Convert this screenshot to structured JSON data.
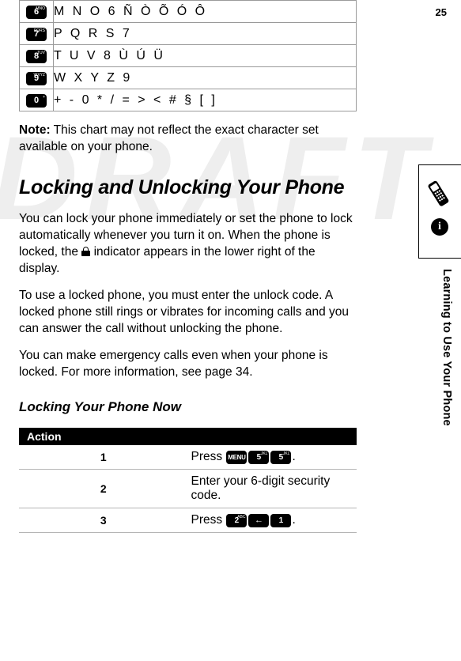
{
  "page": {
    "number": "25",
    "watermark": "DRAFT",
    "rail_title": "Learning to Use Your Phone",
    "rail_info_glyph": "i"
  },
  "chart": {
    "rows": [
      {
        "key": "6",
        "key_sub": "MNO",
        "chars": "M  N  O  6  Ñ  Ò  Õ  Ó  Ô"
      },
      {
        "key": "7",
        "key_sub": "PQRS",
        "chars": "P  Q  R  S  7"
      },
      {
        "key": "8",
        "key_sub": "TUV",
        "chars": "T  U  V  8  Ù  Ú  Ü"
      },
      {
        "key": "9",
        "key_sub": "WXYZ",
        "chars": "W  X  Y  Z  9"
      },
      {
        "key": "0",
        "key_sub": "+",
        "chars": "+  -  0  *  /  =  >  <  #  §  [  ]"
      }
    ]
  },
  "note": {
    "label": "Note:",
    "text": " This chart may not reflect the exact character set available on your phone."
  },
  "section": {
    "title": "Locking and Unlocking Your Phone",
    "para1_a": "You can lock your phone immediately or set the phone to lock automatically whenever you turn it on. When the phone is locked, the ",
    "para1_b": " indicator appears in the lower right of the display.",
    "para2": "To use a locked phone, you must enter the unlock code. A locked phone still rings or vibrates for incoming calls and you can answer the call without unlocking the phone.",
    "para3": "You can make emergency calls even when your phone is locked. For more information, see page 34."
  },
  "subsection": {
    "title": "Locking Your Phone Now"
  },
  "action_table": {
    "header": "Action",
    "rows": [
      {
        "num": "1",
        "text_before": "Press ",
        "keys": [
          {
            "label": "MENU",
            "sub": "",
            "type": "menu"
          },
          {
            "label": "5",
            "sub": "JKL",
            "type": "digit"
          },
          {
            "label": "5",
            "sub": "JKL",
            "type": "digit"
          }
        ],
        "text_after": "."
      },
      {
        "num": "2",
        "text_before": "Enter your 6-digit security code.",
        "keys": [],
        "text_after": ""
      },
      {
        "num": "3",
        "text_before": "Press ",
        "keys": [
          {
            "label": "2",
            "sub": "ABC",
            "type": "digit"
          },
          {
            "label": "←",
            "sub": "",
            "type": "nav"
          },
          {
            "label": "1",
            "sub": "",
            "type": "digit"
          }
        ],
        "text_after": "."
      }
    ]
  }
}
